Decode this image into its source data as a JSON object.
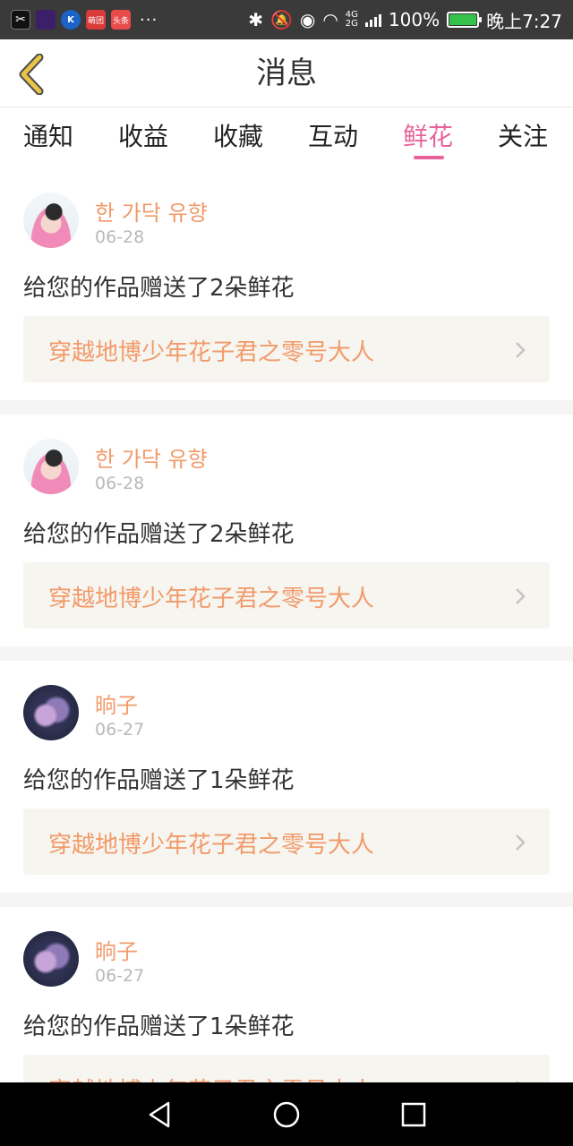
{
  "status_bar": {
    "apps": [
      "capcut",
      "purple-app",
      "kugou",
      "red-app",
      "toutiao"
    ],
    "app_labels": {
      "kugou": "K",
      "red": "萌团",
      "toutiao": "头条"
    },
    "dots": "···",
    "signal_label_top": "4G",
    "signal_label_bottom": "2G",
    "battery": "100%",
    "time": "晚上7:27"
  },
  "header": {
    "title": "消息"
  },
  "tabs": [
    {
      "label": "通知",
      "active": false
    },
    {
      "label": "收益",
      "active": false
    },
    {
      "label": "收藏",
      "active": false
    },
    {
      "label": "互动",
      "active": false
    },
    {
      "label": "鲜花",
      "active": true
    },
    {
      "label": "关注",
      "active": false
    }
  ],
  "messages": [
    {
      "user": "한 가닥 유향",
      "date": "06-28",
      "text": "给您的作品赠送了2朵鲜花",
      "work": "穿越地博少年花子君之零号大人"
    },
    {
      "user": "한 가닥 유향",
      "date": "06-28",
      "text": "给您的作品赠送了2朵鲜花",
      "work": "穿越地博少年花子君之零号大人"
    },
    {
      "user": "晌子",
      "date": "06-27",
      "text": "给您的作品赠送了1朵鲜花",
      "work": "穿越地博少年花子君之零号大人"
    },
    {
      "user": "晌子",
      "date": "06-27",
      "text": "给您的作品赠送了1朵鲜花",
      "work": "穿越地博少年花子君之零号大人"
    }
  ],
  "colors": {
    "accent": "#e8639c",
    "orange": "#f29a6a",
    "back_icon": "#e9c34a"
  },
  "icons": {
    "back": "chevron-left-icon",
    "item_arrow": "chevron-right-icon",
    "nav": [
      "back-triangle-icon",
      "home-circle-icon",
      "recents-square-icon"
    ]
  }
}
